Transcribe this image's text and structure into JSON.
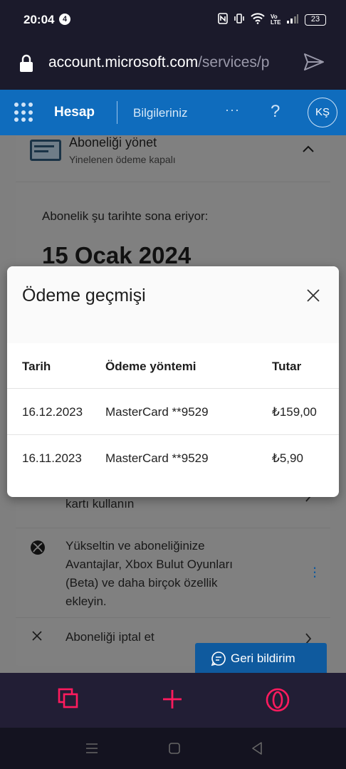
{
  "status_bar": {
    "time": "20:04",
    "notification_count": "4",
    "network_label": "Vo LTE",
    "battery": "23"
  },
  "url_bar": {
    "host": "account.microsoft.com",
    "path": "/services/p"
  },
  "header": {
    "title": "Hesap",
    "subtitle": "Bilgileriniz",
    "more": "···",
    "help": "?",
    "avatar": "KŞ"
  },
  "background_page": {
    "manage_title": "Aboneliği yönet",
    "manage_subtitle": "Yinelenen ödeme kapalı",
    "expire_label": "Abonelik şu tarihte sona eriyor:",
    "expire_date": "15 Ocak 2024",
    "card_row_text": "kartı kullanın",
    "upgrade_text": "Yükseltin ve aboneliğinize Avantajlar, Xbox Bulut Oyunları (Beta) ve daha birçok özellik ekleyin.",
    "cancel_text": "Aboneliği iptal et",
    "feedback_label": "Geri bildirim"
  },
  "modal": {
    "title": "Ödeme geçmişi",
    "columns": [
      "Tarih",
      "Ödeme yöntemi",
      "Tutar"
    ],
    "rows": [
      {
        "date": "16.12.2023",
        "method": "MasterCard **9529",
        "amount": "₺159,00"
      },
      {
        "date": "16.11.2023",
        "method": "MasterCard **9529",
        "amount": "₺5,90"
      }
    ]
  },
  "colors": {
    "ms_blue": "#0f6cbd",
    "browser_dark": "#1b1a2b",
    "opera_red": "#ff1b5e"
  }
}
